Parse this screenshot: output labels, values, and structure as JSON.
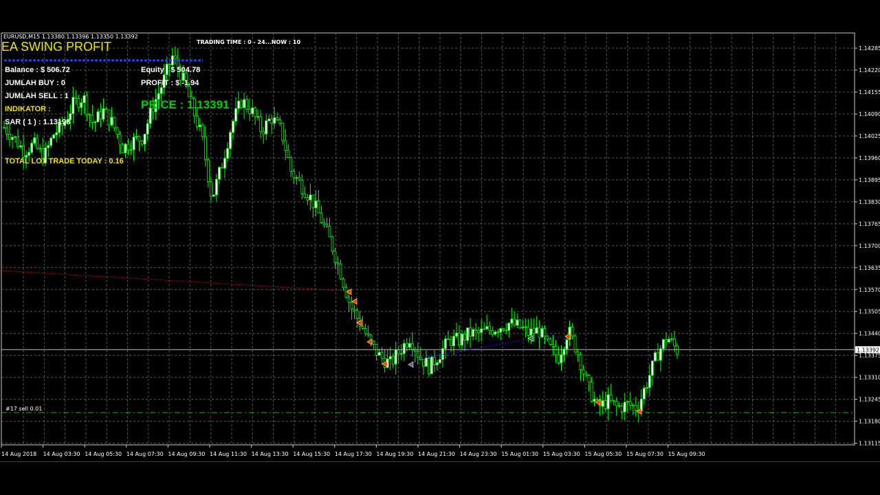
{
  "window": {
    "symbol_line": "EURUSD,M15  1.13380 1.13396 1.13350 1.13392",
    "trading_time": "TRADING TIME : 0 - 24...NOW : 10"
  },
  "panel": {
    "title": "EA SWING PROFIT",
    "balance": "Balance : $ 506.72",
    "equity": "Equity : $ 504.78",
    "jumlah_buy": "JUMLAH BUY   : 0",
    "jumlah_sell": "JUMLAH SELL : 1",
    "profit": "PROFIT   : $ -1.94",
    "indikator": "INDIKATOR :",
    "sar": "SAR ( 1 ) : 1.13198",
    "price": "PRICE : 1.13391",
    "total_lot": "TOTAL LOT TRADE TODAY : 0.16",
    "order_label": "#17 sell 0.01"
  },
  "colors": {
    "background": "#000000",
    "grid": "#5a5a5a",
    "bull_candle": "#ffffff",
    "bear_candle": "#000000",
    "candle_outline": "#00ff00",
    "title_yellow": "#e8e800",
    "price_green": "#00cc00",
    "price_marker": "#ffffff"
  },
  "chart_data": {
    "type": "candlestick",
    "symbol": "EURUSD",
    "timeframe": "M15",
    "y_ticks": [
      "1.14285",
      "1.14220",
      "1.14155",
      "1.14090",
      "1.14025",
      "1.13960",
      "1.13895",
      "1.13830",
      "1.13765",
      "1.13700",
      "1.13635",
      "1.13570",
      "1.13505",
      "1.13440",
      "1.13375",
      "1.13310",
      "1.13245",
      "1.13180",
      "1.13115"
    ],
    "current_price": "1.13392",
    "ylim": [
      1.1311,
      1.1433
    ],
    "x_ticks": [
      "14 Aug 2018",
      "14 Aug 03:30",
      "14 Aug 05:30",
      "14 Aug 07:30",
      "14 Aug 09:30",
      "14 Aug 11:30",
      "14 Aug 13:30",
      "14 Aug 15:30",
      "14 Aug 17:30",
      "14 Aug 19:30",
      "14 Aug 21:30",
      "14 Aug 23:30",
      "15 Aug 01:30",
      "15 Aug 03:30",
      "15 Aug 05:30",
      "15 Aug 07:30",
      "15 Aug 09:30"
    ],
    "price_path": [
      1.1405,
      1.1402,
      1.1398,
      1.14,
      1.1396,
      1.1403,
      1.1406,
      1.1412,
      1.1414,
      1.1406,
      1.141,
      1.1406,
      1.1399,
      1.1401,
      1.1402,
      1.1411,
      1.1418,
      1.1426,
      1.142,
      1.1411,
      1.1402,
      1.1384,
      1.1394,
      1.1406,
      1.1413,
      1.141,
      1.1404,
      1.1408,
      1.1404,
      1.1392,
      1.1388,
      1.1384,
      1.1378,
      1.1371,
      1.1362,
      1.1352,
      1.1347,
      1.1341,
      1.1337,
      1.1335,
      1.1339,
      1.1343,
      1.1337,
      1.1334,
      1.1338,
      1.1342,
      1.1342,
      1.1344,
      1.1344,
      1.1345,
      1.1346,
      1.1347,
      1.1346,
      1.1344,
      1.1345,
      1.134,
      1.1337,
      1.1345,
      1.1338,
      1.1328,
      1.1322,
      1.1324,
      1.1322,
      1.1323,
      1.1322,
      1.133,
      1.1338,
      1.1343,
      1.1339
    ]
  }
}
